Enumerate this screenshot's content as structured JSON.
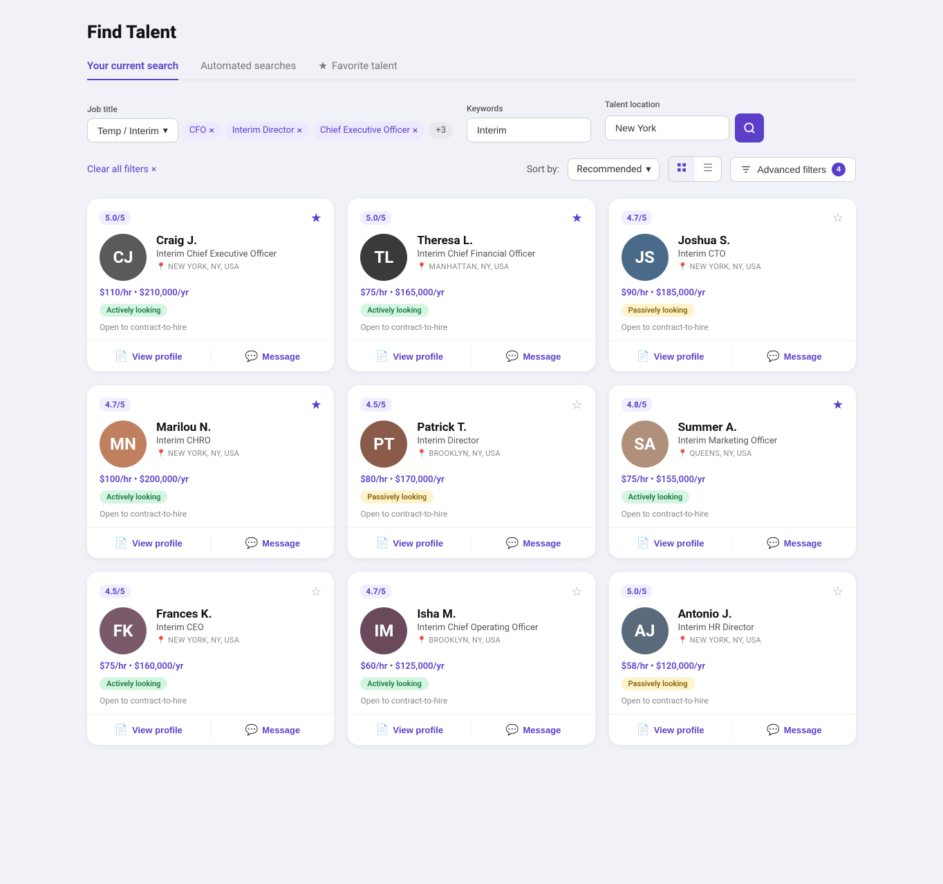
{
  "page": {
    "title": "Find Talent"
  },
  "tabs": [
    {
      "id": "current",
      "label": "Your current search",
      "active": true
    },
    {
      "id": "automated",
      "label": "Automated searches",
      "active": false
    },
    {
      "id": "favorite",
      "label": "Favorite talent",
      "active": false,
      "icon": "★"
    }
  ],
  "filters": {
    "job_title_label": "Job title",
    "job_title_dropdown": "Temp / Interim",
    "tags": [
      {
        "id": "cfo",
        "label": "CFO"
      },
      {
        "id": "interim-director",
        "label": "Interim Director"
      },
      {
        "id": "ceo",
        "label": "Chief Executive Officer"
      }
    ],
    "more_count": "+3",
    "keywords_label": "Keywords",
    "keywords_value": "Interim",
    "keywords_placeholder": "Interim",
    "location_label": "Talent location",
    "location_value": "New York",
    "location_placeholder": "New York"
  },
  "results_bar": {
    "clear_label": "Clear all filters",
    "sort_label": "Sort by:",
    "sort_value": "Recommended",
    "advanced_filters_label": "Advanced filters",
    "advanced_filters_count": "4"
  },
  "candidates": [
    {
      "id": 1,
      "rating": "5.0/5",
      "name": "Craig J.",
      "title": "Interim Chief Executive Officer",
      "location": "NEW YORK, NY, USA",
      "hourly": "$110/hr",
      "yearly": "$210,000/yr",
      "status": "Actively looking",
      "status_type": "actively",
      "contract": "Open to contract-to-hire",
      "starred": true,
      "avatar_color": "#5a5a5a",
      "avatar_initials": "CJ"
    },
    {
      "id": 2,
      "rating": "5.0/5",
      "name": "Theresa L.",
      "title": "Interim Chief Financial Officer",
      "location": "MANHATTAN, NY, USA",
      "hourly": "$75/hr",
      "yearly": "$165,000/yr",
      "status": "Actively looking",
      "status_type": "actively",
      "contract": "Open to contract-to-hire",
      "starred": true,
      "avatar_color": "#3a3a3a",
      "avatar_initials": "TL"
    },
    {
      "id": 3,
      "rating": "4.7/5",
      "name": "Joshua S.",
      "title": "Interim CTO",
      "location": "NEW YORK, NY, USA",
      "hourly": "$90/hr",
      "yearly": "$185,000/yr",
      "status": "Passively looking",
      "status_type": "passively",
      "contract": "Open to contract-to-hire",
      "starred": false,
      "avatar_color": "#4a6a8a",
      "avatar_initials": "JS"
    },
    {
      "id": 4,
      "rating": "4.7/5",
      "name": "Marilou N.",
      "title": "Interim CHRO",
      "location": "NEW YORK, NY, USA",
      "hourly": "$100/hr",
      "yearly": "$200,000/yr",
      "status": "Actively looking",
      "status_type": "actively",
      "contract": "Open to contract-to-hire",
      "starred": true,
      "avatar_color": "#c08060",
      "avatar_initials": "MN"
    },
    {
      "id": 5,
      "rating": "4.5/5",
      "name": "Patrick T.",
      "title": "Interim Director",
      "location": "BROOKLYN, NY, USA",
      "hourly": "$80/hr",
      "yearly": "$170,000/yr",
      "status": "Passively looking",
      "status_type": "passively",
      "contract": "Open to contract-to-hire",
      "starred": false,
      "avatar_color": "#8a5a4a",
      "avatar_initials": "PT"
    },
    {
      "id": 6,
      "rating": "4.8/5",
      "name": "Summer A.",
      "title": "Interim Marketing Officer",
      "location": "QUEENS, NY, USA",
      "hourly": "$75/hr",
      "yearly": "$155,000/yr",
      "status": "Actively looking",
      "status_type": "actively",
      "contract": "Open to contract-to-hire",
      "starred": true,
      "avatar_color": "#b0907a",
      "avatar_initials": "SA"
    },
    {
      "id": 7,
      "rating": "4.5/5",
      "name": "Frances K.",
      "title": "Interim CEO",
      "location": "NEW YORK, NY, USA",
      "hourly": "$75/hr",
      "yearly": "$160,000/yr",
      "status": "Actively looking",
      "status_type": "actively",
      "contract": "Open to contract-to-hire",
      "starred": false,
      "avatar_color": "#7a5a6a",
      "avatar_initials": "FK"
    },
    {
      "id": 8,
      "rating": "4.7/5",
      "name": "Isha M.",
      "title": "Interim Chief Operating Officer",
      "location": "BROOKLYN, NY, USA",
      "hourly": "$60/hr",
      "yearly": "$125,000/yr",
      "status": "Actively looking",
      "status_type": "actively",
      "contract": "Open to contract-to-hire",
      "starred": false,
      "avatar_color": "#6a4a5a",
      "avatar_initials": "IM"
    },
    {
      "id": 9,
      "rating": "5.0/5",
      "name": "Antonio J.",
      "title": "Interim HR Director",
      "location": "NEW YORK, NY, USA",
      "hourly": "$58/hr",
      "yearly": "$120,000/yr",
      "status": "Passively looking",
      "status_type": "passively",
      "contract": "Open to contract-to-hire",
      "starred": false,
      "avatar_color": "#5a6a7a",
      "avatar_initials": "AJ"
    }
  ],
  "buttons": {
    "view_profile": "View profile",
    "message": "Message"
  }
}
